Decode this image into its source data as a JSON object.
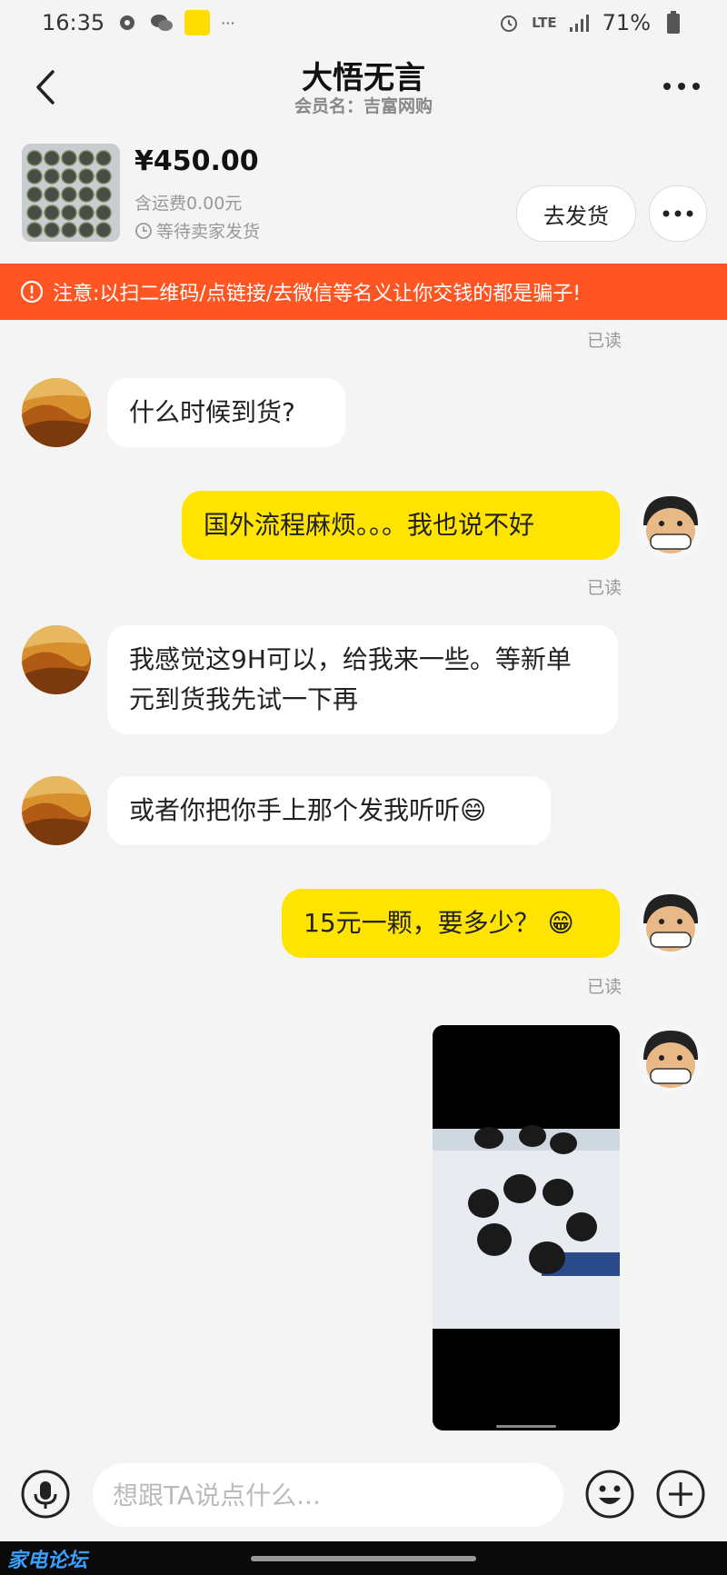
{
  "status_bar": {
    "time": "16:35",
    "more": "···",
    "network": "LTE",
    "battery": "71%"
  },
  "header": {
    "title": "大悟无言",
    "subtitle": "会员名：吉富网购"
  },
  "order": {
    "price": "¥450.00",
    "shipping": "含运费0.00元",
    "status": "等待卖家发货",
    "ship_button": "去发货"
  },
  "warning": {
    "text": "注意:以扫二维码/点链接/去微信等名义让你交钱的都是骗子!"
  },
  "messages": {
    "read_label": "已读",
    "m1": "什么时候到货?",
    "m2": "国外流程麻烦。。。我也说不好",
    "m3": "我感觉这9H可以，给我来一些。等新单元到货我先试一下再",
    "m4": "或者你把你手上那个发我听听😄",
    "m5": "15元一颗，要多少？ 😁"
  },
  "input": {
    "placeholder": "想跟TA说点什么..."
  },
  "watermark": {
    "text": "家电论坛"
  },
  "colors": {
    "accent_yellow": "#ffe400",
    "warning_orange": "#ff5522"
  }
}
